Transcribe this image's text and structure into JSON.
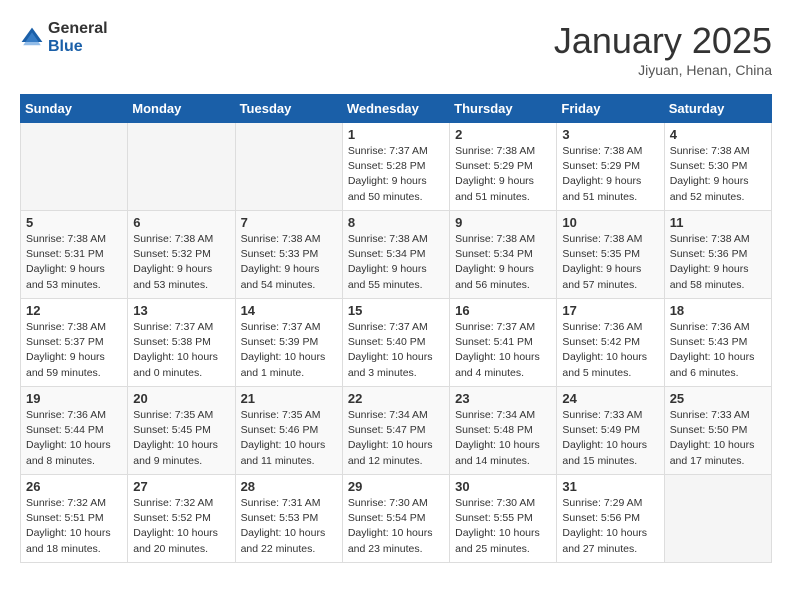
{
  "header": {
    "logo_general": "General",
    "logo_blue": "Blue",
    "month_title": "January 2025",
    "subtitle": "Jiyuan, Henan, China"
  },
  "days_of_week": [
    "Sunday",
    "Monday",
    "Tuesday",
    "Wednesday",
    "Thursday",
    "Friday",
    "Saturday"
  ],
  "weeks": [
    [
      {
        "day": "",
        "info": ""
      },
      {
        "day": "",
        "info": ""
      },
      {
        "day": "",
        "info": ""
      },
      {
        "day": "1",
        "info": "Sunrise: 7:37 AM\nSunset: 5:28 PM\nDaylight: 9 hours\nand 50 minutes."
      },
      {
        "day": "2",
        "info": "Sunrise: 7:38 AM\nSunset: 5:29 PM\nDaylight: 9 hours\nand 51 minutes."
      },
      {
        "day": "3",
        "info": "Sunrise: 7:38 AM\nSunset: 5:29 PM\nDaylight: 9 hours\nand 51 minutes."
      },
      {
        "day": "4",
        "info": "Sunrise: 7:38 AM\nSunset: 5:30 PM\nDaylight: 9 hours\nand 52 minutes."
      }
    ],
    [
      {
        "day": "5",
        "info": "Sunrise: 7:38 AM\nSunset: 5:31 PM\nDaylight: 9 hours\nand 53 minutes."
      },
      {
        "day": "6",
        "info": "Sunrise: 7:38 AM\nSunset: 5:32 PM\nDaylight: 9 hours\nand 53 minutes."
      },
      {
        "day": "7",
        "info": "Sunrise: 7:38 AM\nSunset: 5:33 PM\nDaylight: 9 hours\nand 54 minutes."
      },
      {
        "day": "8",
        "info": "Sunrise: 7:38 AM\nSunset: 5:34 PM\nDaylight: 9 hours\nand 55 minutes."
      },
      {
        "day": "9",
        "info": "Sunrise: 7:38 AM\nSunset: 5:34 PM\nDaylight: 9 hours\nand 56 minutes."
      },
      {
        "day": "10",
        "info": "Sunrise: 7:38 AM\nSunset: 5:35 PM\nDaylight: 9 hours\nand 57 minutes."
      },
      {
        "day": "11",
        "info": "Sunrise: 7:38 AM\nSunset: 5:36 PM\nDaylight: 9 hours\nand 58 minutes."
      }
    ],
    [
      {
        "day": "12",
        "info": "Sunrise: 7:38 AM\nSunset: 5:37 PM\nDaylight: 9 hours\nand 59 minutes."
      },
      {
        "day": "13",
        "info": "Sunrise: 7:37 AM\nSunset: 5:38 PM\nDaylight: 10 hours\nand 0 minutes."
      },
      {
        "day": "14",
        "info": "Sunrise: 7:37 AM\nSunset: 5:39 PM\nDaylight: 10 hours\nand 1 minute."
      },
      {
        "day": "15",
        "info": "Sunrise: 7:37 AM\nSunset: 5:40 PM\nDaylight: 10 hours\nand 3 minutes."
      },
      {
        "day": "16",
        "info": "Sunrise: 7:37 AM\nSunset: 5:41 PM\nDaylight: 10 hours\nand 4 minutes."
      },
      {
        "day": "17",
        "info": "Sunrise: 7:36 AM\nSunset: 5:42 PM\nDaylight: 10 hours\nand 5 minutes."
      },
      {
        "day": "18",
        "info": "Sunrise: 7:36 AM\nSunset: 5:43 PM\nDaylight: 10 hours\nand 6 minutes."
      }
    ],
    [
      {
        "day": "19",
        "info": "Sunrise: 7:36 AM\nSunset: 5:44 PM\nDaylight: 10 hours\nand 8 minutes."
      },
      {
        "day": "20",
        "info": "Sunrise: 7:35 AM\nSunset: 5:45 PM\nDaylight: 10 hours\nand 9 minutes."
      },
      {
        "day": "21",
        "info": "Sunrise: 7:35 AM\nSunset: 5:46 PM\nDaylight: 10 hours\nand 11 minutes."
      },
      {
        "day": "22",
        "info": "Sunrise: 7:34 AM\nSunset: 5:47 PM\nDaylight: 10 hours\nand 12 minutes."
      },
      {
        "day": "23",
        "info": "Sunrise: 7:34 AM\nSunset: 5:48 PM\nDaylight: 10 hours\nand 14 minutes."
      },
      {
        "day": "24",
        "info": "Sunrise: 7:33 AM\nSunset: 5:49 PM\nDaylight: 10 hours\nand 15 minutes."
      },
      {
        "day": "25",
        "info": "Sunrise: 7:33 AM\nSunset: 5:50 PM\nDaylight: 10 hours\nand 17 minutes."
      }
    ],
    [
      {
        "day": "26",
        "info": "Sunrise: 7:32 AM\nSunset: 5:51 PM\nDaylight: 10 hours\nand 18 minutes."
      },
      {
        "day": "27",
        "info": "Sunrise: 7:32 AM\nSunset: 5:52 PM\nDaylight: 10 hours\nand 20 minutes."
      },
      {
        "day": "28",
        "info": "Sunrise: 7:31 AM\nSunset: 5:53 PM\nDaylight: 10 hours\nand 22 minutes."
      },
      {
        "day": "29",
        "info": "Sunrise: 7:30 AM\nSunset: 5:54 PM\nDaylight: 10 hours\nand 23 minutes."
      },
      {
        "day": "30",
        "info": "Sunrise: 7:30 AM\nSunset: 5:55 PM\nDaylight: 10 hours\nand 25 minutes."
      },
      {
        "day": "31",
        "info": "Sunrise: 7:29 AM\nSunset: 5:56 PM\nDaylight: 10 hours\nand 27 minutes."
      },
      {
        "day": "",
        "info": ""
      }
    ]
  ]
}
